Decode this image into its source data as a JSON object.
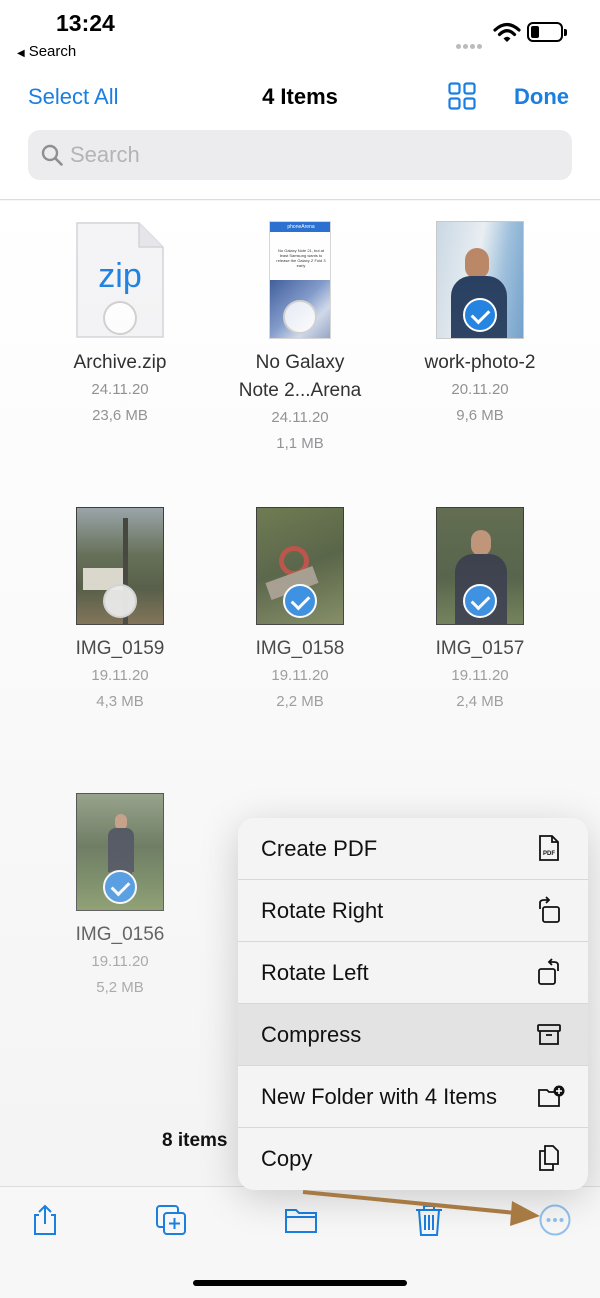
{
  "status": {
    "time": "13:24",
    "back_app": "Search"
  },
  "nav": {
    "select_all": "Select All",
    "title": "4 Items",
    "done": "Done",
    "search_placeholder": "Search"
  },
  "files": [
    {
      "name": "Archive.zip",
      "date": "24.11.20",
      "size": "23,6 MB",
      "selected": false,
      "thumb_label": "zip"
    },
    {
      "name": "No Galaxy Note 2...Arena",
      "name_line1": "No Galaxy",
      "name_line2": "Note 2...Arena",
      "date": "24.11.20",
      "size": "1,1 MB",
      "selected": false,
      "thumb_header": "phoneArena",
      "thumb_headline": "No Galaxy Note 21, but at least Samsung wants to release the Galaxy Z Fold 3 early"
    },
    {
      "name": "work-photo-2",
      "date": "20.11.20",
      "size": "9,6 MB",
      "selected": true
    },
    {
      "name": "IMG_0159",
      "date": "19.11.20",
      "size": "4,3 MB",
      "selected": false
    },
    {
      "name": "IMG_0158",
      "date": "19.11.20",
      "size": "2,2 MB",
      "selected": true
    },
    {
      "name": "IMG_0157",
      "date": "19.11.20",
      "size": "2,4 MB",
      "selected": true
    },
    {
      "name": "IMG_0156",
      "date": "19.11.20",
      "size": "5,2 MB",
      "selected": true
    }
  ],
  "menu": [
    {
      "label": "Create PDF",
      "icon": "pdf-doc-icon",
      "highlighted": false
    },
    {
      "label": "Rotate Right",
      "icon": "rotate-right-icon",
      "highlighted": false
    },
    {
      "label": "Rotate Left",
      "icon": "rotate-left-icon",
      "highlighted": false
    },
    {
      "label": "Compress",
      "icon": "archive-box-icon",
      "highlighted": true
    },
    {
      "label": "New Folder with 4 Items",
      "icon": "folder-plus-icon",
      "highlighted": false
    },
    {
      "label": "Copy",
      "icon": "copy-doc-icon",
      "highlighted": false
    }
  ],
  "footer": {
    "count": "8 items"
  },
  "toolbar": [
    "share-icon",
    "duplicate-icon",
    "move-folder-icon",
    "trash-icon",
    "more-icon"
  ],
  "colors": {
    "accent": "#1a7fe0",
    "annotation_arrow": "#a87a43"
  }
}
